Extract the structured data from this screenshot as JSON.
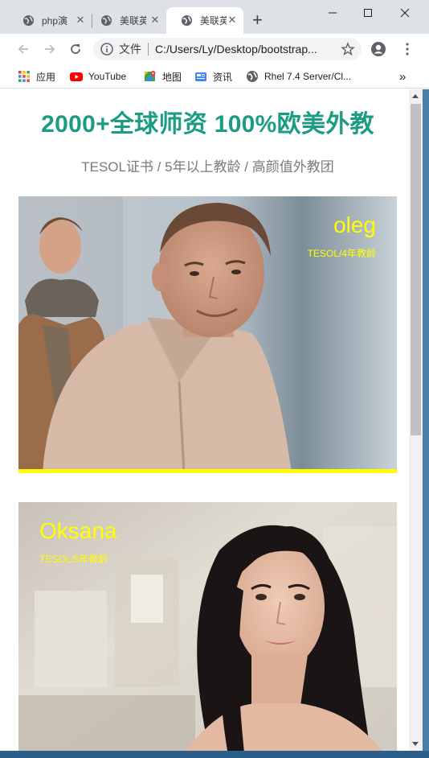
{
  "browser": {
    "tabs": [
      {
        "title": "php演",
        "active": false
      },
      {
        "title": "美联英",
        "active": false
      },
      {
        "title": "美联英",
        "active": true
      }
    ],
    "new_tab_icon": "plus-icon",
    "address": {
      "scheme_label": "文件",
      "url": "C:/Users/Ly/Desktop/bootstrap..."
    },
    "bookmarks": [
      {
        "label": "应用",
        "icon": "apps-grid-icon"
      },
      {
        "label": "YouTube",
        "icon": "youtube-icon"
      },
      {
        "label": "地图",
        "icon": "maps-icon"
      },
      {
        "label": "资讯",
        "icon": "news-icon"
      },
      {
        "label": "Rhel 7.4 Server/Cl...",
        "icon": "globe-icon"
      }
    ],
    "bookmarks_overflow": "»"
  },
  "page": {
    "headline": "2000+全球师资 100%欧美外教",
    "subline": "TESOL证书 / 5年以上教龄 / 高颜值外教团",
    "teachers": [
      {
        "name": "oleg",
        "desc": "TESOL/4年教龄"
      },
      {
        "name": "Oksana",
        "desc": "TESOL/5年教龄"
      }
    ]
  },
  "colors": {
    "headline": "#1d9c84",
    "subline": "#7a7a7a",
    "accent_yellow": "#ffff00",
    "chrome_bg": "#dee1e6"
  }
}
